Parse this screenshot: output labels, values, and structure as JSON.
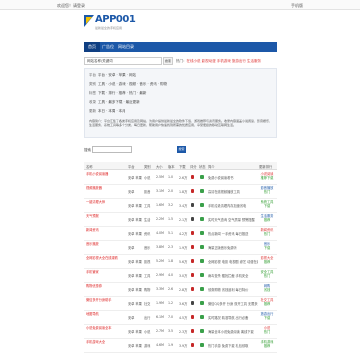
{
  "topbar": {
    "left": "欢迎您！请登录",
    "right": "手机版"
  },
  "brand": {
    "logo": "APP001",
    "tagline": "最新最全的手机应用"
  },
  "nav": {
    "items": [
      "首页",
      "广告位",
      "网站目录"
    ]
  },
  "search": {
    "placeholder": "网站名称/关键词",
    "button": "搜索",
    "hot_label": "热门：",
    "hot_text": "在线小说 影视动漫 手机游戏 旅游出行 生活服务"
  },
  "info": {
    "rows": [
      {
        "k": "平台",
        "v": "平台 · 安卓 · 苹果 · 网站"
      },
      {
        "k": "类别",
        "v": "工具 · 小说 · 游戏 · 视频 · 音乐 · 资讯 · 购物"
      },
      {
        "k": "标签",
        "v": "下载 · 排行 · 推荐 · 热门 · 最新"
      },
      {
        "k": "收录",
        "v": "工具 · 最多下载 · 最近更新"
      },
      {
        "k": "更新",
        "v": "本日 · 本周 · 本月"
      }
    ],
    "intro_label": "内容简介",
    "intro": "平台汇集了各类手机应用及网站，为用户提供最新最全的软件下载、游戏推荐与资讯服务。收录内容涵盖小说阅读、影音娱乐、生活服务、系统工具等多个分类，每日更新，帮助用户快速找到所需的优质应用，享受便捷的移动互联网生活。"
  },
  "filter": {
    "label": "搜索",
    "button": "搜索"
  },
  "table": {
    "headers": [
      "名称",
      "平台",
      "类别",
      "大小",
      "版本",
      "下载",
      "评分",
      "状态",
      "简介",
      "更新排行"
    ],
    "rows": [
      {
        "name": "手机小说阅读器",
        "platform": "安卓 苹果",
        "cat": "小说",
        "size": "2.5M",
        "ver": "1.0",
        "dl": "2.6万",
        "icon": "red",
        "status": "green",
        "desc": "免费小说阅读看书",
        "rank_label": "小说阅读",
        "rank_sub": "推荐下载",
        "rank_color": "rd"
      },
      {
        "name": "视频播放器",
        "platform": "安卓",
        "cat": "影音",
        "size": "3.1M",
        "ver": "2.0",
        "dl": "1.8万",
        "icon": "red",
        "status": "green",
        "desc": "高清在线视频播放工具",
        "rank_label": "影音播放",
        "rank_sub": "热门",
        "rank_color": "n"
      },
      {
        "name": "一键清理大师",
        "platform": "安卓 苹果",
        "cat": "工具",
        "size": "1.6M",
        "ver": "3.2",
        "dl": "3.4万",
        "icon": "dark",
        "status": "green",
        "desc": "手机垃圾清理内存加速省电",
        "rank_label": "系统工具",
        "rank_sub": "下载",
        "rank_color": "g"
      },
      {
        "name": "天气预报",
        "platform": "安卓 苹果",
        "cat": "生活",
        "size": "2.2M",
        "ver": "1.5",
        "dl": "2.1万",
        "icon": "dark",
        "status": "green",
        "desc": "实时天气查询 空气质量 预警提醒",
        "rank_label": "生活服务",
        "rank_sub": "推荐",
        "rank_color": "n"
      },
      {
        "name": "新闻资讯",
        "platform": "安卓 苹果",
        "cat": "资讯",
        "size": "4.0M",
        "ver": "5.1",
        "dl": "4.2万",
        "icon": "red",
        "status": "green",
        "desc": "热点新闻 一手资讯 每日推送",
        "rank_label": "新闻资讯",
        "rank_sub": "热门",
        "rank_color": "rd"
      },
      {
        "name": "音乐播放",
        "platform": "安卓",
        "cat": "音乐",
        "size": "3.8M",
        "ver": "2.3",
        "dl": "1.9万",
        "icon": "red",
        "status": "green",
        "desc": "海量正版音乐免费听",
        "rank_label": "音乐",
        "rank_sub": "下载",
        "rank_color": "n"
      },
      {
        "name": "全网影视大全在线观看",
        "platform": "安卓 苹果",
        "cat": "影视",
        "size": "5.2M",
        "ver": "1.8",
        "dl": "5.6万",
        "icon": "red",
        "status": "green",
        "desc": "全网影视 电影 电视剧 综艺 动漫在线看",
        "rank_label": "影视大全",
        "rank_sub": "推荐",
        "rank_color": "rd"
      },
      {
        "name": "手机管家",
        "platform": "安卓 苹果",
        "cat": "工具",
        "size": "2.9M",
        "ver": "4.0",
        "dl": "3.0万",
        "icon": "red",
        "status": "green",
        "desc": "病毒查杀 骚扰拦截 手机安全",
        "rank_label": "安全工具",
        "rank_sub": "热门",
        "rank_color": "g"
      },
      {
        "name": "购物优惠券",
        "platform": "安卓 苹果",
        "cat": "购物",
        "size": "3.3M",
        "ver": "2.6",
        "dl": "2.8万",
        "icon": "red",
        "status": "green",
        "desc": "领券购物 省钱返利 每日特价",
        "rank_label": "网购",
        "rank_sub": "省钱",
        "rank_color": "n"
      },
      {
        "name": "微信多开分身助手",
        "platform": "安卓 苹果",
        "cat": "社交",
        "size": "1.9M",
        "ver": "1.2",
        "dl": "3.6万",
        "icon": "dark",
        "status": "green",
        "desc": "微信QQ多开 分身 双开工具 无限多开",
        "rank_label": "社交工具",
        "rank_sub": "推荐",
        "rank_color": "rd"
      },
      {
        "name": "地图导航",
        "platform": "安卓",
        "cat": "出行",
        "size": "6.1M",
        "ver": "7.0",
        "dl": "4.5万",
        "icon": "red",
        "status": "green",
        "desc": "实时路况 精准导航 出行必备",
        "rank_label": "旅游出行",
        "rank_sub": "下载",
        "rank_color": "n"
      },
      {
        "name": "小说免费阅读全本",
        "platform": "安卓 苹果",
        "cat": "小说",
        "size": "2.7M",
        "ver": "3.5",
        "dl": "2.3万",
        "icon": "red",
        "status": "green",
        "desc": "海量全本小说免费阅读 离线下载",
        "rank_label": "小说",
        "rank_sub": "热门",
        "rank_color": "rd"
      },
      {
        "name": "手机游戏大全",
        "platform": "安卓 苹果",
        "cat": "游戏",
        "size": "4.6M",
        "ver": "1.9",
        "dl": "3.9万",
        "icon": "red",
        "status": "green",
        "desc": "热门手游 免费下载 礼包领取",
        "rank_label": "手机游戏",
        "rank_sub": "推荐",
        "rank_color": "g"
      }
    ]
  },
  "colors": {
    "primary": "#1c58a8",
    "accent": "#f4c300",
    "link": "#dd2222"
  }
}
